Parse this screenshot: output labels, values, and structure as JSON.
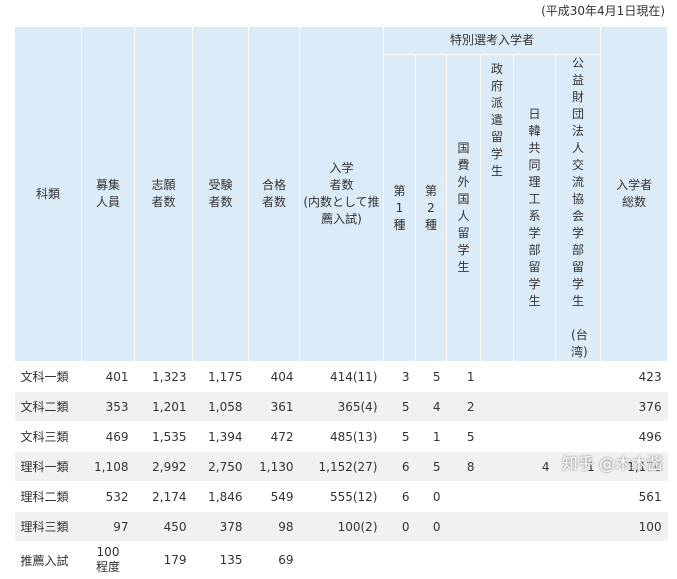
{
  "as_of": "(平成30年4月1日現在)",
  "headers": {
    "category": "科類",
    "quota": [
      "募集",
      "人員"
    ],
    "applicants": [
      "志願",
      "者数"
    ],
    "examinees": [
      "受験",
      "者数"
    ],
    "passed": [
      "合格",
      "者数"
    ],
    "enrolled": [
      "入学",
      "者数",
      "(内数として推",
      "薦入試)"
    ],
    "special_group": "特別選考入学者",
    "special1": [
      "第",
      "1",
      "種"
    ],
    "special2": [
      "第",
      "2",
      "種"
    ],
    "intl": [
      "国",
      "費",
      "外",
      "国",
      "人",
      "留",
      "学",
      "生"
    ],
    "govt": [
      "政",
      "府",
      "派",
      "遣",
      "留",
      "学",
      "生"
    ],
    "jk": [
      "日",
      "韓",
      "共",
      "同",
      "理",
      "工",
      "系",
      "学",
      "部",
      "留",
      "学",
      "生"
    ],
    "taiwan": [
      "公",
      "益",
      "財",
      "団",
      "法",
      "人",
      "交",
      "流",
      "協",
      "会",
      "学",
      "部",
      "留",
      "学",
      "生",
      "",
      "(台",
      "湾)"
    ],
    "total": [
      "入学者",
      "総数"
    ]
  },
  "rows": [
    {
      "category": "文科一類",
      "quota": "401",
      "applicants": "1,323",
      "examinees": "1,175",
      "passed": "404",
      "enrolled": "414(11)",
      "special1": "3",
      "special2": "5",
      "intl": "1",
      "govt": "",
      "jk": "",
      "taiwan": "",
      "total": "423"
    },
    {
      "category": "文科二類",
      "quota": "353",
      "applicants": "1,201",
      "examinees": "1,058",
      "passed": "361",
      "enrolled": "365(4)",
      "special1": "5",
      "special2": "4",
      "intl": "2",
      "govt": "",
      "jk": "",
      "taiwan": "",
      "total": "376"
    },
    {
      "category": "文科三類",
      "quota": "469",
      "applicants": "1,535",
      "examinees": "1,394",
      "passed": "472",
      "enrolled": "485(13)",
      "special1": "5",
      "special2": "1",
      "intl": "5",
      "govt": "",
      "jk": "",
      "taiwan": "",
      "total": "496"
    },
    {
      "category": "理科一類",
      "quota": "1,108",
      "applicants": "2,992",
      "examinees": "2,750",
      "passed": "1,130",
      "enrolled": "1,152(27)",
      "special1": "6",
      "special2": "5",
      "intl": "8",
      "govt": "",
      "jk": "4",
      "taiwan": "1",
      "total": "1,176"
    },
    {
      "category": "理科二類",
      "quota": "532",
      "applicants": "2,174",
      "examinees": "1,846",
      "passed": "549",
      "enrolled": "555(12)",
      "special1": "6",
      "special2": "0",
      "intl": "",
      "govt": "",
      "jk": "",
      "taiwan": "",
      "total": "561"
    },
    {
      "category": "理科三類",
      "quota": "97",
      "applicants": "450",
      "examinees": "378",
      "passed": "98",
      "enrolled": "100(2)",
      "special1": "0",
      "special2": "0",
      "intl": "",
      "govt": "",
      "jk": "",
      "taiwan": "",
      "total": "100"
    },
    {
      "category": "推薦入試",
      "quota": "100\n程度",
      "applicants": "179",
      "examinees": "135",
      "passed": "69",
      "enrolled": "",
      "special1": "",
      "special2": "",
      "intl": "",
      "govt": "",
      "jk": "",
      "taiwan": "",
      "total": ""
    }
  ],
  "watermark": "知乎 @木木酱"
}
